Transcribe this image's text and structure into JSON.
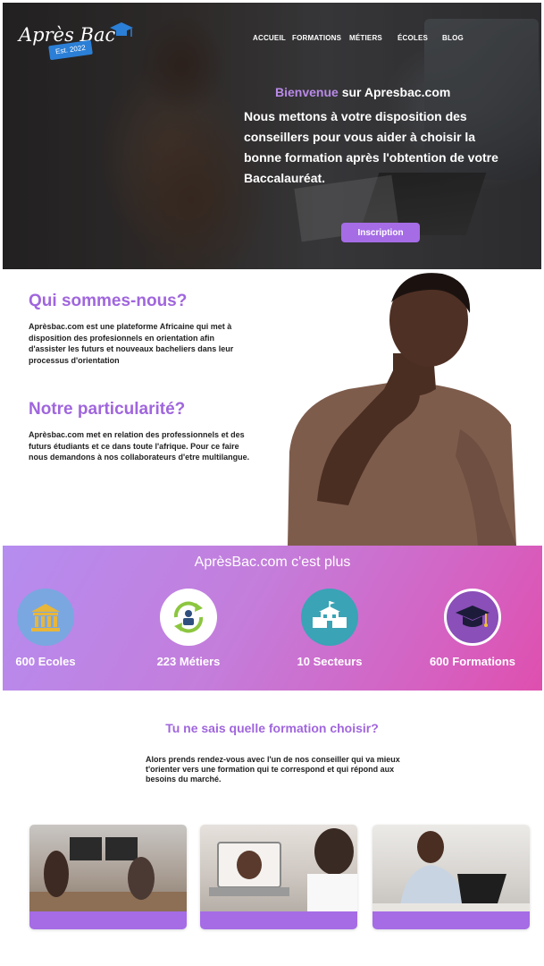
{
  "colors": {
    "accent_purple": "#a56ce6",
    "title_purple": "#a066dd",
    "band_gradient_start": "#b58df0",
    "band_gradient_end": "#df4fae"
  },
  "header": {
    "logo_text": "Après Bac",
    "logo_badge": "Est. 2022",
    "logo_icon": "graduation-cap-icon",
    "nav": [
      "ACCUEIL",
      "FORMATIONS",
      "MÉTIERS",
      "ÉCOLES",
      "BLOG"
    ]
  },
  "hero": {
    "welcome_accent": "Bienvenue",
    "welcome_rest": " sur Apresbac.com",
    "text": "Nous mettons à votre disposition des conseillers pour vous aider à choisir la bonne formation après l'obtention de votre Baccalauréat.",
    "button": "Inscription"
  },
  "about": {
    "title": "Qui sommes-nous?",
    "text": "Aprèsbac.com est une plateforme Africaine qui met à disposition des profesionnels en orientation afin d'assister les futurs et nouveaux bacheliers dans leur processus d'orientation",
    "partic_title": "Notre particularité?",
    "partic_text": "Aprèsbac.com met en relation des professionnels et des futurs étudiants et ce dans toute l'afrique. Pour ce faire nous demandons à nos collaborateurs d'etre multilangue."
  },
  "stats": {
    "title": "AprèsBac.com c'est plus",
    "items": [
      {
        "label": "600 Ecoles",
        "icon": "school-building-icon"
      },
      {
        "label": "223 Métiers",
        "icon": "career-cycle-icon"
      },
      {
        "label": "10 Secteurs",
        "icon": "school-house-icon"
      },
      {
        "label": "600 Formations",
        "icon": "mortarboard-icon"
      }
    ]
  },
  "cta": {
    "title": "Tu ne sais quelle formation choisir?",
    "text": "Alors prends rendez-vous avec l'un de nos conseiller qui va mieux t'orienter vers une formation qui te correspond et qui répond aux besoins du marché."
  }
}
